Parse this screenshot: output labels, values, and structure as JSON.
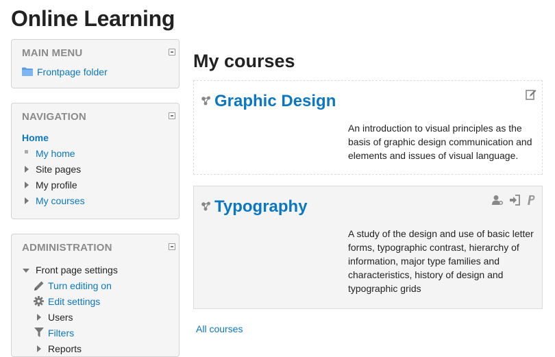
{
  "site": {
    "title": "Online Learning"
  },
  "main_menu": {
    "title": "MAIN MENU",
    "items": [
      {
        "label": "Frontpage folder",
        "icon": "folder-icon"
      }
    ]
  },
  "navigation": {
    "title": "NAVIGATION",
    "home": "Home",
    "items": [
      {
        "label": "My home",
        "icon": "square-bullet"
      },
      {
        "label": "Site pages",
        "icon": "expand-arrow"
      },
      {
        "label": "My profile",
        "icon": "expand-arrow"
      },
      {
        "label": "My courses",
        "icon": "expand-arrow"
      }
    ]
  },
  "administration": {
    "title": "ADMINISTRATION",
    "section": "Front page settings",
    "items": [
      {
        "label": "Turn editing on",
        "icon": "pencil-icon"
      },
      {
        "label": "Edit settings",
        "icon": "gear-icon"
      },
      {
        "label": "Users",
        "icon": "expand-arrow"
      },
      {
        "label": "Filters",
        "icon": "funnel-icon"
      },
      {
        "label": "Reports",
        "icon": "expand-arrow"
      }
    ]
  },
  "main": {
    "heading": "My courses",
    "courses": [
      {
        "name": "Graphic Design",
        "summary": "An introduction to visual principles as the basis of graphic design communication and elements and issues of visual language.",
        "enrol_icons": [
          "self-enrol-icon"
        ]
      },
      {
        "name": "Typography",
        "summary": "A study of the design and use of basic letter forms, typographic contrast, hierarchy of information, major type families and characteristics, history of design and typographic grids",
        "enrol_icons": [
          "guest-access-icon",
          "self-enrol-icon",
          "paypal-icon"
        ]
      }
    ],
    "all_courses_link": "All courses"
  },
  "colors": {
    "link": "#0b77c0",
    "block_bg": "#f5f5f5",
    "heading": "#222222"
  }
}
